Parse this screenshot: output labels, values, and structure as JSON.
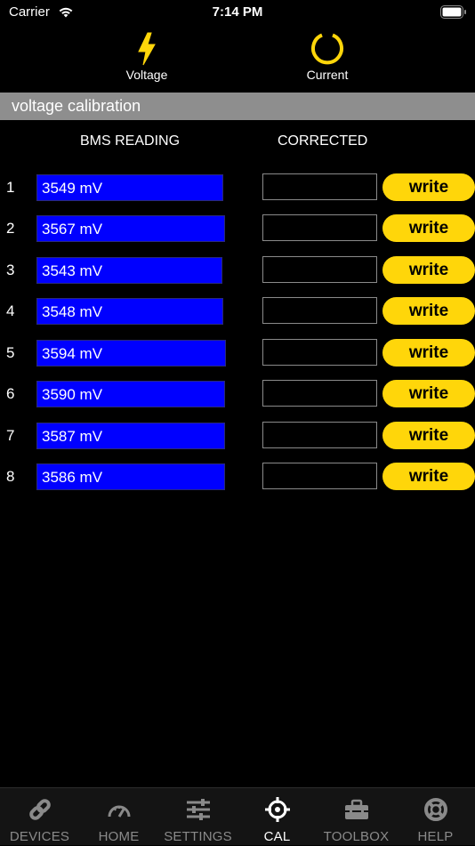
{
  "status_bar": {
    "carrier": "Carrier",
    "time": "7:14 PM"
  },
  "modes": [
    {
      "label": "Voltage",
      "icon": "lightning-bolt-icon",
      "color": "#ffd60a"
    },
    {
      "label": "Current",
      "icon": "power-ring-icon",
      "color": "#ffd60a"
    }
  ],
  "section": {
    "title": "voltage calibration"
  },
  "columns": {
    "bms_reading": "BMS READING",
    "corrected": "CORRECTED"
  },
  "rows": [
    {
      "index": "1",
      "reading": "3549 mV",
      "corrected": "",
      "write_label": "write"
    },
    {
      "index": "2",
      "reading": "3567 mV",
      "corrected": "",
      "write_label": "write"
    },
    {
      "index": "3",
      "reading": "3543 mV",
      "corrected": "",
      "write_label": "write"
    },
    {
      "index": "4",
      "reading": "3548 mV",
      "corrected": "",
      "write_label": "write"
    },
    {
      "index": "5",
      "reading": "3594 mV",
      "corrected": "",
      "write_label": "write"
    },
    {
      "index": "6",
      "reading": "3590 mV",
      "corrected": "",
      "write_label": "write"
    },
    {
      "index": "7",
      "reading": "3587 mV",
      "corrected": "",
      "write_label": "write"
    },
    {
      "index": "8",
      "reading": "3586 mV",
      "corrected": "",
      "write_label": "write"
    }
  ],
  "tab_bar": {
    "active": "CAL",
    "tabs": [
      {
        "label": "DEVICES",
        "icon": "link-icon"
      },
      {
        "label": "HOME",
        "icon": "speedometer-icon"
      },
      {
        "label": "SETTINGS",
        "icon": "sliders-icon"
      },
      {
        "label": "CAL",
        "icon": "crosshair-icon"
      },
      {
        "label": "TOOLBOX",
        "icon": "toolbox-icon"
      },
      {
        "label": "HELP",
        "icon": "lifebuoy-icon"
      }
    ]
  },
  "colors": {
    "accent": "#ffd60a",
    "reading_bg": "#0000ff",
    "section_bg": "#8e8e8e",
    "background": "#000000"
  }
}
